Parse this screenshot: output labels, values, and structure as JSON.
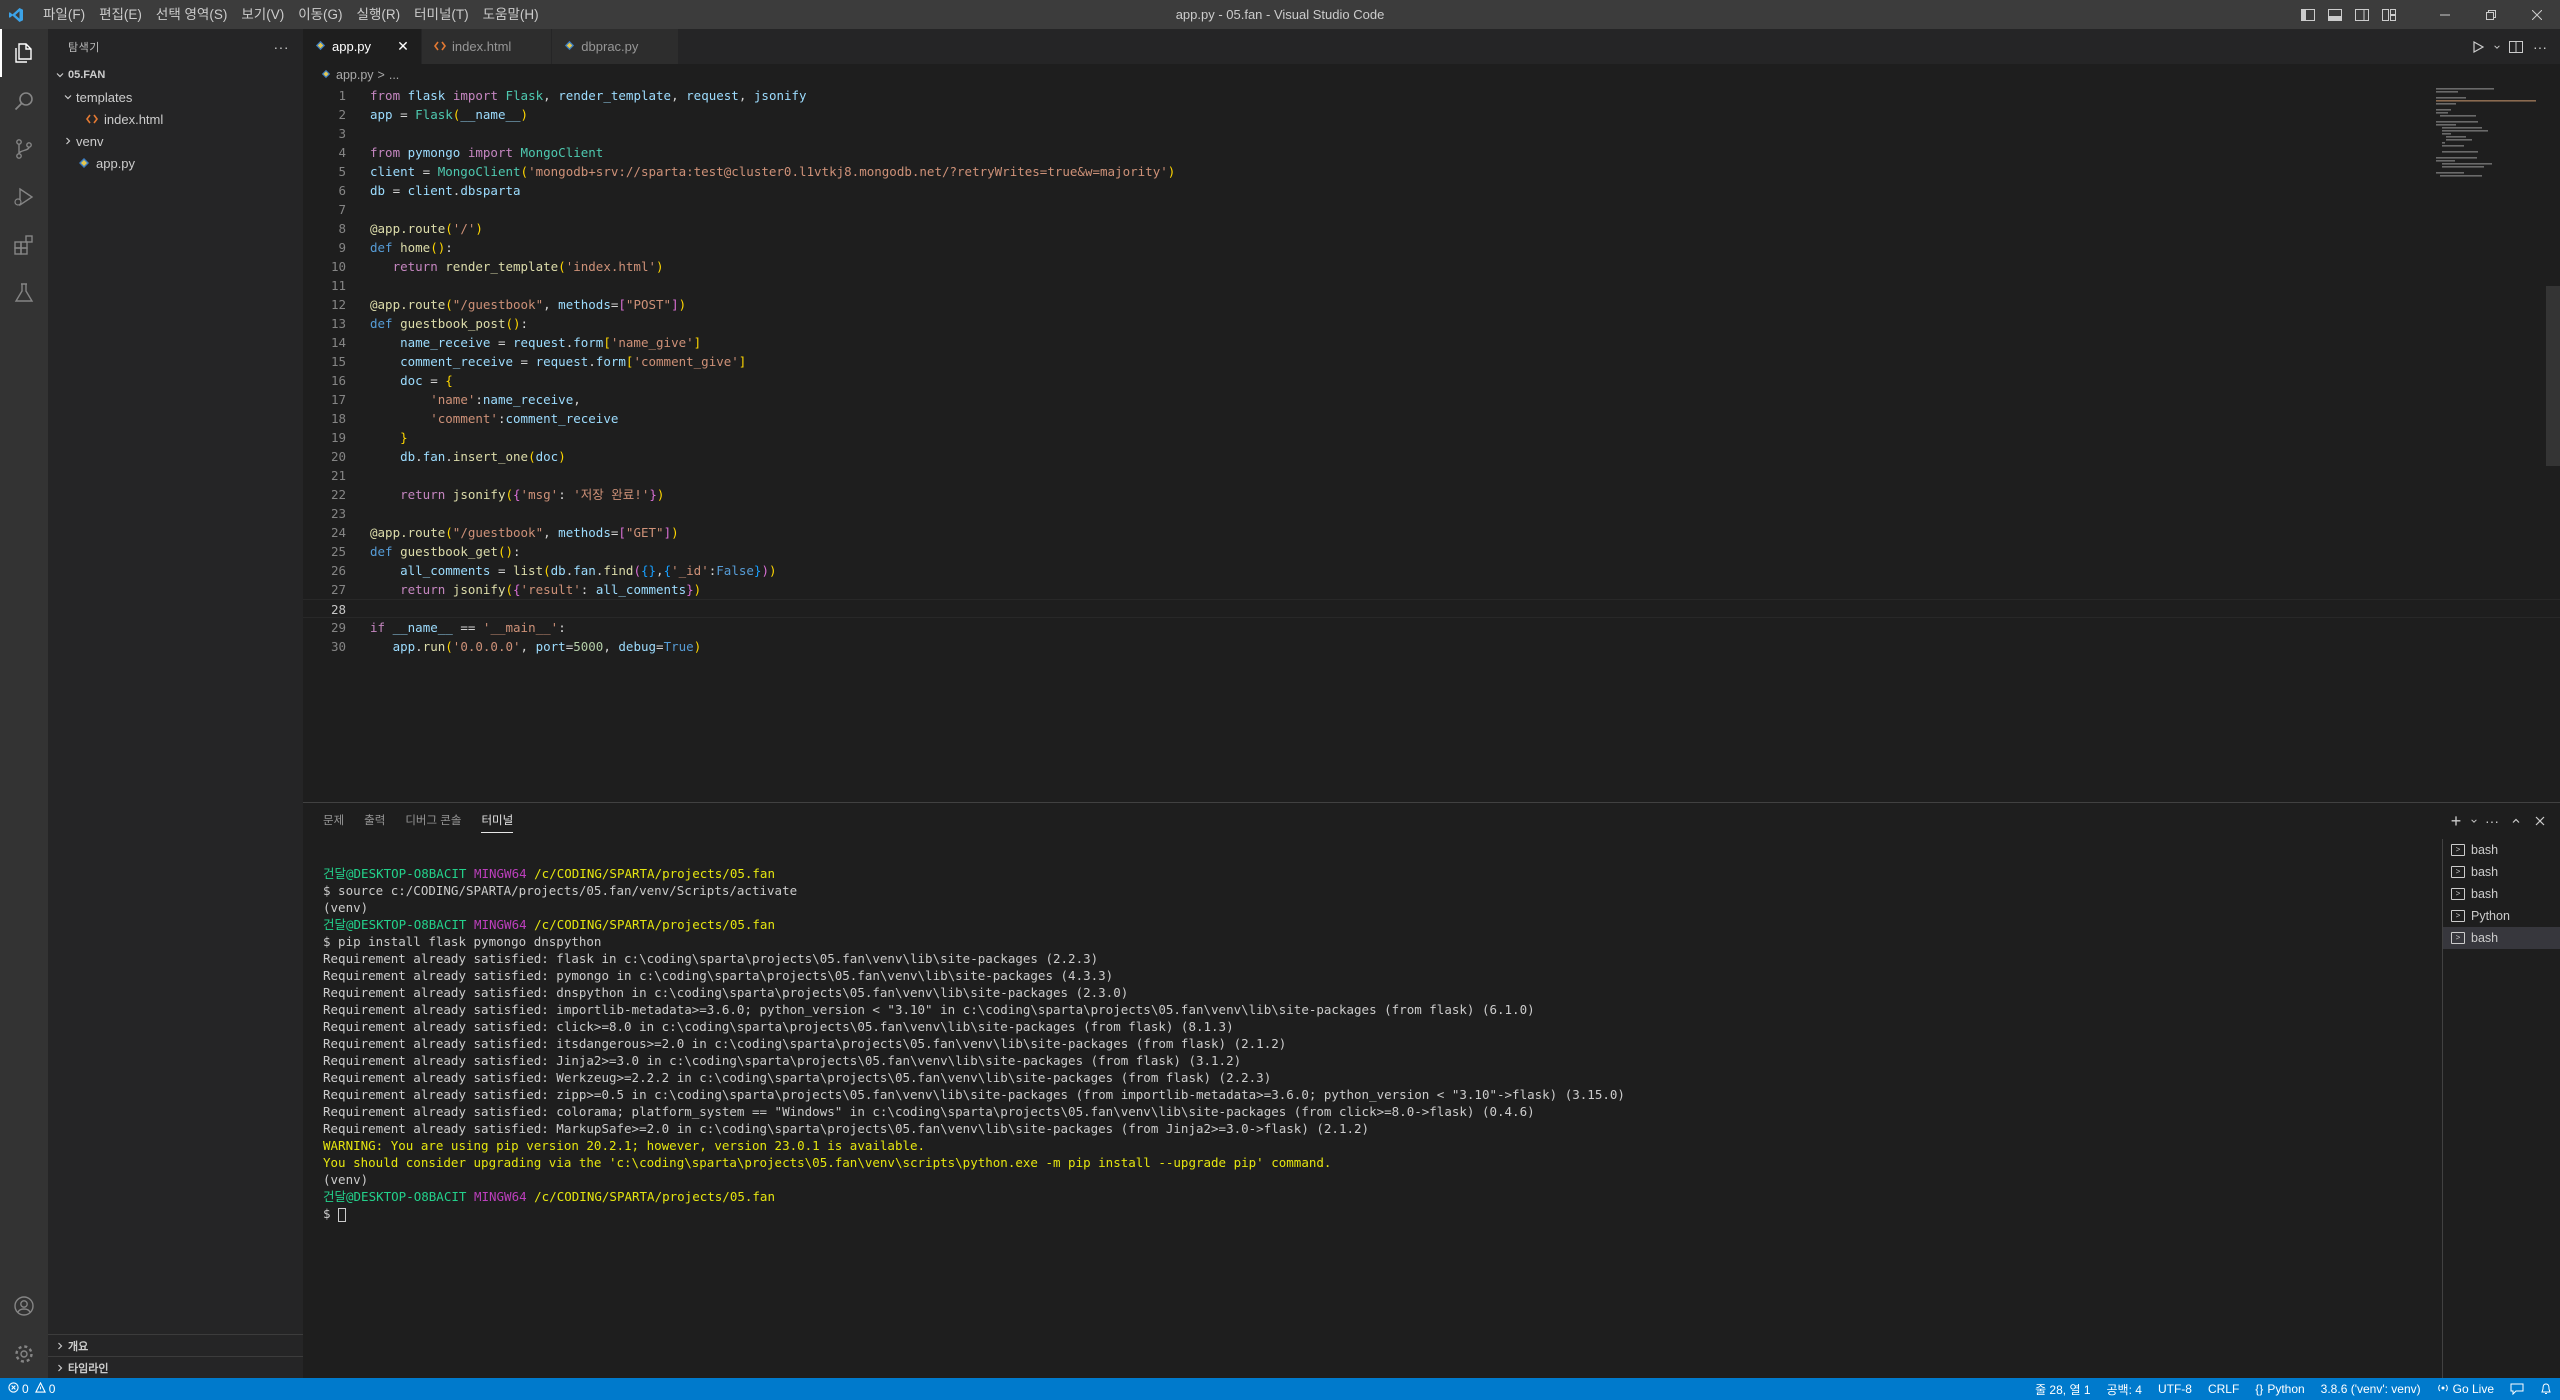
{
  "window": {
    "title": "app.py - 05.fan - Visual Studio Code"
  },
  "menu": [
    "파일(F)",
    "편집(E)",
    "선택 영역(S)",
    "보기(V)",
    "이동(G)",
    "실행(R)",
    "터미널(T)",
    "도움말(H)"
  ],
  "sidebar": {
    "header": "탐색기",
    "more": "···",
    "folder": "05.FAN",
    "tree": [
      {
        "label": "templates",
        "type": "folder",
        "open": true,
        "depth": 1
      },
      {
        "label": "index.html",
        "type": "html",
        "depth": 2
      },
      {
        "label": "venv",
        "type": "folder",
        "open": false,
        "depth": 1
      },
      {
        "label": "app.py",
        "type": "python",
        "depth": 1
      }
    ],
    "outline": "개요",
    "timeline": "타임라인"
  },
  "tabs": [
    {
      "label": "app.py",
      "icon": "python-icon",
      "active": true
    },
    {
      "label": "index.html",
      "icon": "html-icon",
      "active": false
    },
    {
      "label": "dbprac.py",
      "icon": "python-icon",
      "active": false
    }
  ],
  "breadcrumb": {
    "file": "app.py",
    "sep": ">",
    "rest": "..."
  },
  "code": {
    "lines": [
      "from flask import Flask, render_template, request, jsonify",
      "app = Flask(__name__)",
      "",
      "from pymongo import MongoClient",
      "client = MongoClient('mongodb+srv://sparta:test@cluster0.l1vtkj8.mongodb.net/?retryWrites=true&w=majority')",
      "db = client.dbsparta",
      "",
      "@app.route('/')",
      "def home():",
      "   return render_template('index.html')",
      "",
      "@app.route(\"/guestbook\", methods=[\"POST\"])",
      "def guestbook_post():",
      "    name_receive = request.form['name_give']",
      "    comment_receive = request.form['comment_give']",
      "    doc = {",
      "        'name':name_receive,",
      "        'comment':comment_receive",
      "    }",
      "    db.fan.insert_one(doc)",
      "",
      "    return jsonify({'msg': '저장 완료!'})",
      "",
      "@app.route(\"/guestbook\", methods=[\"GET\"])",
      "def guestbook_get():",
      "    all_comments = list(db.fan.find({},{'_id':False}))",
      "    return jsonify({'result': all_comments})",
      "",
      "if __name__ == '__main__':",
      "   app.run('0.0.0.0', port=5000, debug=True)"
    ],
    "current_line": 28
  },
  "panel": {
    "tabs": [
      "문제",
      "출력",
      "디버그 콘솔",
      "터미널"
    ],
    "active_tab": "터미널",
    "terminal_lines": [
      {
        "kind": "prompt",
        "user": "건달@DESKTOP-O8BACIT",
        "env": "MINGW64",
        "path": "/c/CODING/SPARTA/projects/05.fan"
      },
      {
        "kind": "text",
        "text": "$ source c:/CODING/SPARTA/projects/05.fan/venv/Scripts/activate"
      },
      {
        "kind": "text",
        "text": "(venv)"
      },
      {
        "kind": "prompt",
        "user": "건달@DESKTOP-O8BACIT",
        "env": "MINGW64",
        "path": "/c/CODING/SPARTA/projects/05.fan"
      },
      {
        "kind": "text",
        "text": "$ pip install flask pymongo dnspython"
      },
      {
        "kind": "text",
        "text": "Requirement already satisfied: flask in c:\\coding\\sparta\\projects\\05.fan\\venv\\lib\\site-packages (2.2.3)"
      },
      {
        "kind": "text",
        "text": "Requirement already satisfied: pymongo in c:\\coding\\sparta\\projects\\05.fan\\venv\\lib\\site-packages (4.3.3)"
      },
      {
        "kind": "text",
        "text": "Requirement already satisfied: dnspython in c:\\coding\\sparta\\projects\\05.fan\\venv\\lib\\site-packages (2.3.0)"
      },
      {
        "kind": "text",
        "text": "Requirement already satisfied: importlib-metadata>=3.6.0; python_version < \"3.10\" in c:\\coding\\sparta\\projects\\05.fan\\venv\\lib\\site-packages (from flask) (6.1.0)"
      },
      {
        "kind": "text",
        "text": "Requirement already satisfied: click>=8.0 in c:\\coding\\sparta\\projects\\05.fan\\venv\\lib\\site-packages (from flask) (8.1.3)"
      },
      {
        "kind": "text",
        "text": "Requirement already satisfied: itsdangerous>=2.0 in c:\\coding\\sparta\\projects\\05.fan\\venv\\lib\\site-packages (from flask) (2.1.2)"
      },
      {
        "kind": "text",
        "text": "Requirement already satisfied: Jinja2>=3.0 in c:\\coding\\sparta\\projects\\05.fan\\venv\\lib\\site-packages (from flask) (3.1.2)"
      },
      {
        "kind": "text",
        "text": "Requirement already satisfied: Werkzeug>=2.2.2 in c:\\coding\\sparta\\projects\\05.fan\\venv\\lib\\site-packages (from flask) (2.2.3)"
      },
      {
        "kind": "text",
        "text": "Requirement already satisfied: zipp>=0.5 in c:\\coding\\sparta\\projects\\05.fan\\venv\\lib\\site-packages (from importlib-metadata>=3.6.0; python_version < \"3.10\"->flask) (3.15.0)"
      },
      {
        "kind": "text",
        "text": "Requirement already satisfied: colorama; platform_system == \"Windows\" in c:\\coding\\sparta\\projects\\05.fan\\venv\\lib\\site-packages (from click>=8.0->flask) (0.4.6)"
      },
      {
        "kind": "text",
        "text": "Requirement already satisfied: MarkupSafe>=2.0 in c:\\coding\\sparta\\projects\\05.fan\\venv\\lib\\site-packages (from Jinja2>=3.0->flask) (2.1.2)"
      },
      {
        "kind": "warn",
        "text": "WARNING: You are using pip version 20.2.1; however, version 23.0.1 is available."
      },
      {
        "kind": "warn",
        "text": "You should consider upgrading via the 'c:\\coding\\sparta\\projects\\05.fan\\venv\\scripts\\python.exe -m pip install --upgrade pip' command."
      },
      {
        "kind": "text",
        "text": "(venv)"
      },
      {
        "kind": "prompt",
        "user": "건달@DESKTOP-O8BACIT",
        "env": "MINGW64",
        "path": "/c/CODING/SPARTA/projects/05.fan"
      },
      {
        "kind": "cursor",
        "text": "$ "
      }
    ],
    "terminals": [
      {
        "label": "bash",
        "active": false
      },
      {
        "label": "bash",
        "active": false
      },
      {
        "label": "bash",
        "active": false
      },
      {
        "label": "Python",
        "active": false
      },
      {
        "label": "bash",
        "active": true
      }
    ]
  },
  "statusbar": {
    "errors": "0",
    "warnings": "0",
    "position": "줄 28, 열 1",
    "spaces": "공백: 4",
    "encoding": "UTF-8",
    "eol": "CRLF",
    "language": "Python",
    "interpreter": "3.8.6 ('venv': venv)",
    "golive": "Go Live"
  },
  "colors": {
    "accent": "#007acc",
    "titlebar": "#3c3c3c",
    "activitybar": "#333333",
    "sidebar": "#252526",
    "editor": "#1e1e1e"
  }
}
